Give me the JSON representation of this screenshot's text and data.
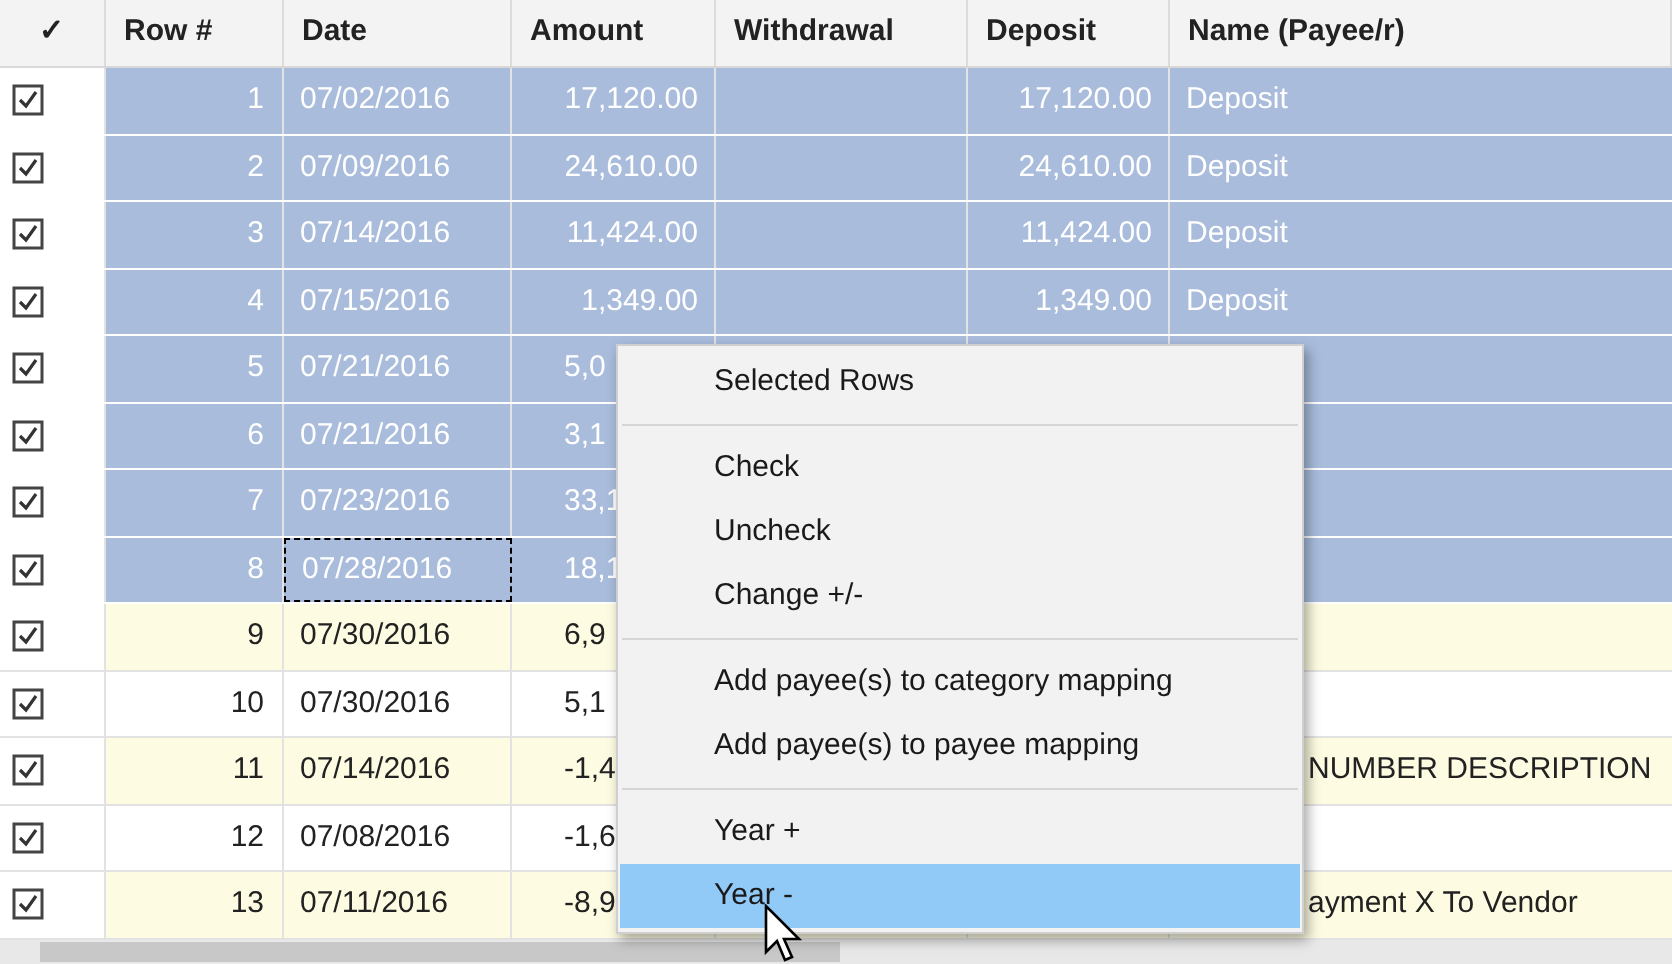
{
  "table": {
    "columns": [
      "✓",
      "Row #",
      "Date",
      "Amount",
      "Withdrawal",
      "Deposit",
      "Name (Payee/r)"
    ],
    "rows": [
      {
        "checked": true,
        "selected": true,
        "focused": false,
        "row": "1",
        "date": "07/02/2016",
        "amount": "17,120.00",
        "withdrawal": "",
        "deposit": "17,120.00",
        "name": "Deposit"
      },
      {
        "checked": true,
        "selected": true,
        "focused": false,
        "row": "2",
        "date": "07/09/2016",
        "amount": "24,610.00",
        "withdrawal": "",
        "deposit": "24,610.00",
        "name": "Deposit"
      },
      {
        "checked": true,
        "selected": true,
        "focused": false,
        "row": "3",
        "date": "07/14/2016",
        "amount": "11,424.00",
        "withdrawal": "",
        "deposit": "11,424.00",
        "name": "Deposit"
      },
      {
        "checked": true,
        "selected": true,
        "focused": false,
        "row": "4",
        "date": "07/15/2016",
        "amount": "1,349.00",
        "withdrawal": "",
        "deposit": "1,349.00",
        "name": "Deposit"
      },
      {
        "checked": true,
        "selected": true,
        "focused": false,
        "row": "5",
        "date": "07/21/2016",
        "amount": "5,0"
      },
      {
        "checked": true,
        "selected": true,
        "focused": false,
        "row": "6",
        "date": "07/21/2016",
        "amount": "3,1"
      },
      {
        "checked": true,
        "selected": true,
        "focused": false,
        "row": "7",
        "date": "07/23/2016",
        "amount": "33,1"
      },
      {
        "checked": true,
        "selected": true,
        "focused": true,
        "row": "8",
        "date": "07/28/2016",
        "amount": "18,1"
      },
      {
        "checked": true,
        "selected": false,
        "focused": false,
        "row": "9",
        "date": "07/30/2016",
        "amount": "6,9"
      },
      {
        "checked": true,
        "selected": false,
        "focused": false,
        "row": "10",
        "date": "07/30/2016",
        "amount": "5,1"
      },
      {
        "checked": true,
        "selected": false,
        "focused": false,
        "row": "11",
        "date": "07/14/2016",
        "amount": "-1,4",
        "name": "NUMBER DESCRIPTION"
      },
      {
        "checked": true,
        "selected": false,
        "focused": false,
        "row": "12",
        "date": "07/08/2016",
        "amount": "-1,6"
      },
      {
        "checked": true,
        "selected": false,
        "focused": false,
        "row": "13",
        "date": "07/11/2016",
        "amount": "-8,9",
        "name": "ayment X To Vendor"
      }
    ]
  },
  "context_menu": {
    "items": [
      {
        "kind": "item",
        "label": "Selected Rows",
        "selected": false
      },
      {
        "kind": "separator"
      },
      {
        "kind": "item",
        "label": "Check",
        "selected": false
      },
      {
        "kind": "item",
        "label": "Uncheck",
        "selected": false
      },
      {
        "kind": "item",
        "label": "Change +/-",
        "selected": false
      },
      {
        "kind": "separator"
      },
      {
        "kind": "item",
        "label": "Add payee(s) to category mapping",
        "selected": false
      },
      {
        "kind": "item",
        "label": "Add payee(s) to payee mapping",
        "selected": false
      },
      {
        "kind": "separator"
      },
      {
        "kind": "item",
        "label": "Year +",
        "selected": false
      },
      {
        "kind": "item",
        "label": "Year -",
        "selected": true
      }
    ]
  }
}
